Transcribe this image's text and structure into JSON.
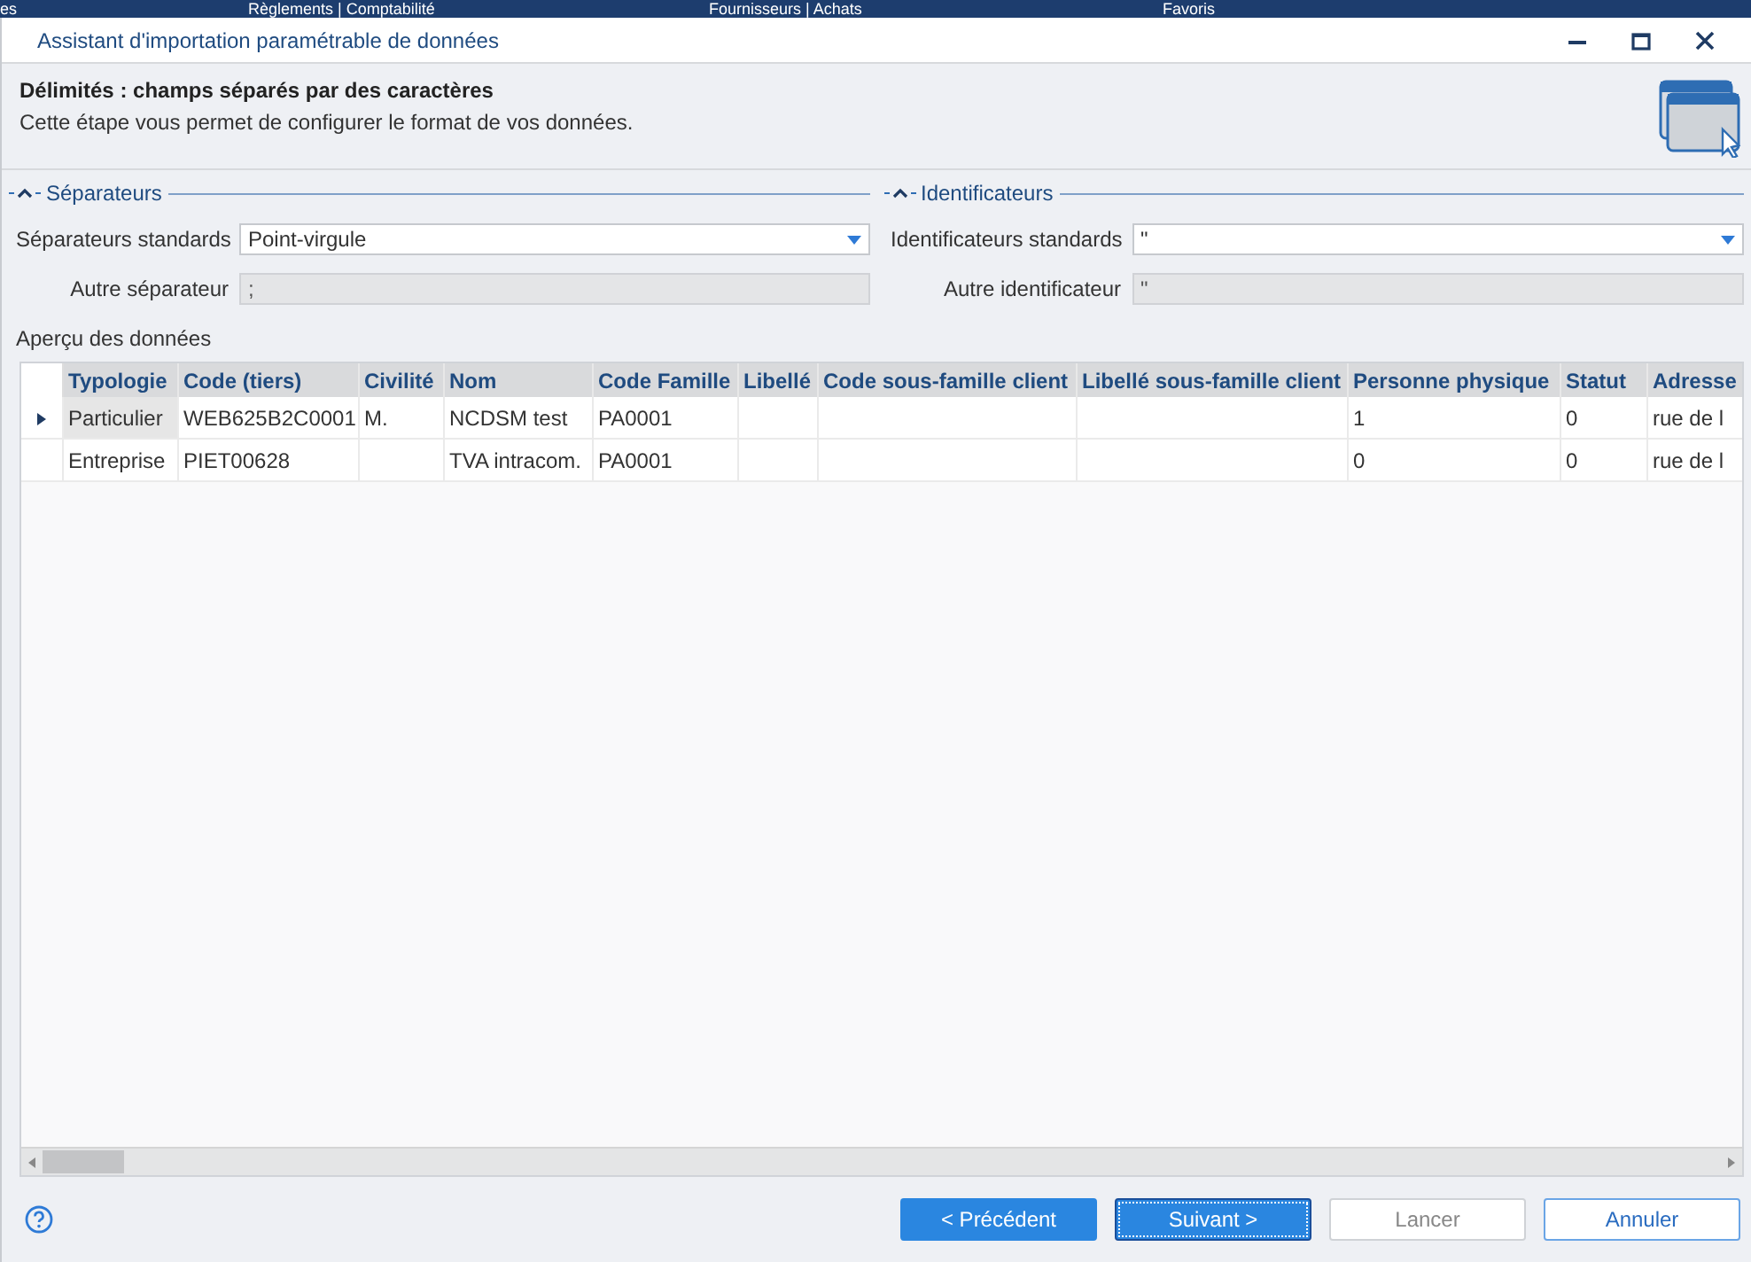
{
  "background_menu": [
    "es",
    "Règlements | Comptabilité",
    "Fournisseurs | Achats",
    "Favoris"
  ],
  "window": {
    "title": "Assistant d'importation paramétrable de données"
  },
  "header": {
    "title": "Délimités : champs séparés par des caractères",
    "subtitle": "Cette étape vous permet de configurer le format de vos données."
  },
  "groups": [
    {
      "title": "Séparateurs",
      "expanded": true,
      "standard_label": "Séparateurs standards",
      "standard_value": "Point-virgule",
      "other_label": "Autre séparateur",
      "other_value": ";"
    },
    {
      "title": "Identificateurs",
      "expanded": true,
      "standard_label": "Identificateurs standards",
      "standard_value": "\"",
      "other_label": "Autre identificateur",
      "other_value": "\""
    }
  ],
  "preview": {
    "label": "Aperçu des données",
    "columns": [
      "Typologie",
      "Code (tiers)",
      "Civilité",
      "Nom",
      "Code Famille",
      "Libellé",
      "Code sous-famille client",
      "Libellé sous-famille client",
      "Personne physique",
      "Statut",
      "Adresse"
    ],
    "rows": [
      {
        "selected": true,
        "cells": [
          "Particulier",
          "WEB625B2C0001",
          "M.",
          "NCDSM test",
          "PA0001",
          "",
          "",
          "",
          "1",
          "0",
          "rue de l"
        ]
      },
      {
        "selected": false,
        "cells": [
          "Entreprise",
          "PIET00628",
          "",
          "TVA intracom.",
          "PA0001",
          "",
          "",
          "",
          "0",
          "0",
          "rue de l"
        ]
      }
    ]
  },
  "buttons": [
    {
      "label": "< Précédent",
      "kind": "primary",
      "disabled": false,
      "focused": false
    },
    {
      "label": "Suivant >",
      "kind": "primary",
      "disabled": false,
      "focused": true
    },
    {
      "label": "Lancer",
      "kind": "outline",
      "disabled": true,
      "focused": false
    },
    {
      "label": "Annuler",
      "kind": "outline",
      "disabled": false,
      "focused": false
    }
  ]
}
